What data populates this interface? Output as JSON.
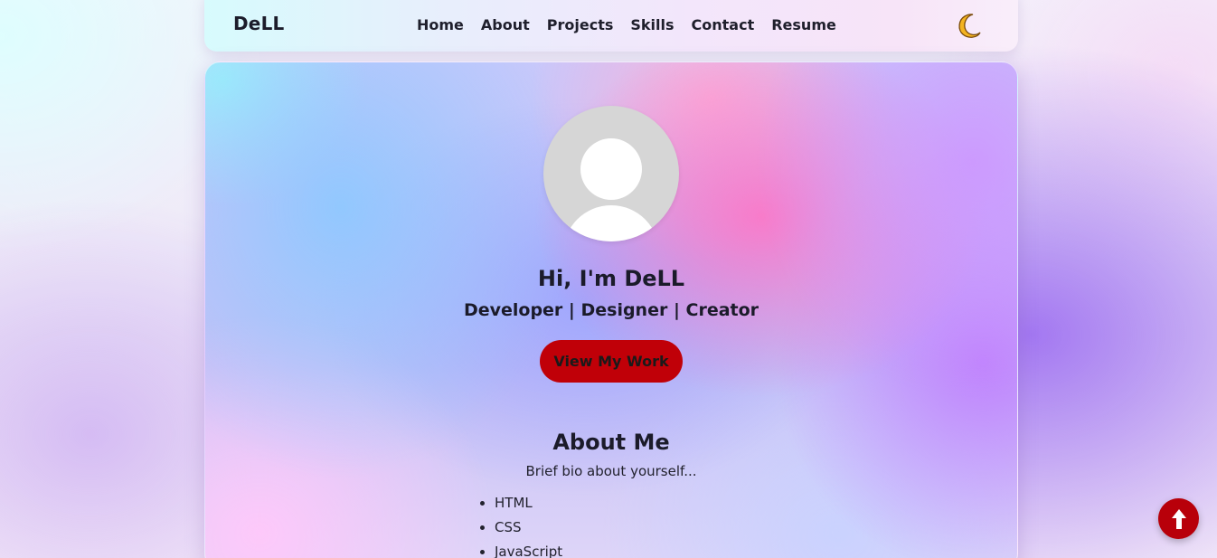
{
  "navbar": {
    "brand": "DeLL",
    "links": [
      "Home",
      "About",
      "Projects",
      "Skills",
      "Contact",
      "Resume"
    ],
    "theme_toggle_icon": "moon-icon"
  },
  "hero": {
    "avatar_icon": "user-avatar-placeholder",
    "title": "Hi, I'm DeLL",
    "subtitle": "Developer | Designer | Creator",
    "cta_label": "View My Work"
  },
  "about": {
    "title": "About Me",
    "text": "Brief bio about yourself...",
    "skills": [
      "HTML",
      "CSS",
      "JavaScript"
    ]
  },
  "scroll_top": {
    "icon": "arrow-up-icon"
  },
  "colors": {
    "accent": "#c00008",
    "text": "#1b1b2a"
  }
}
